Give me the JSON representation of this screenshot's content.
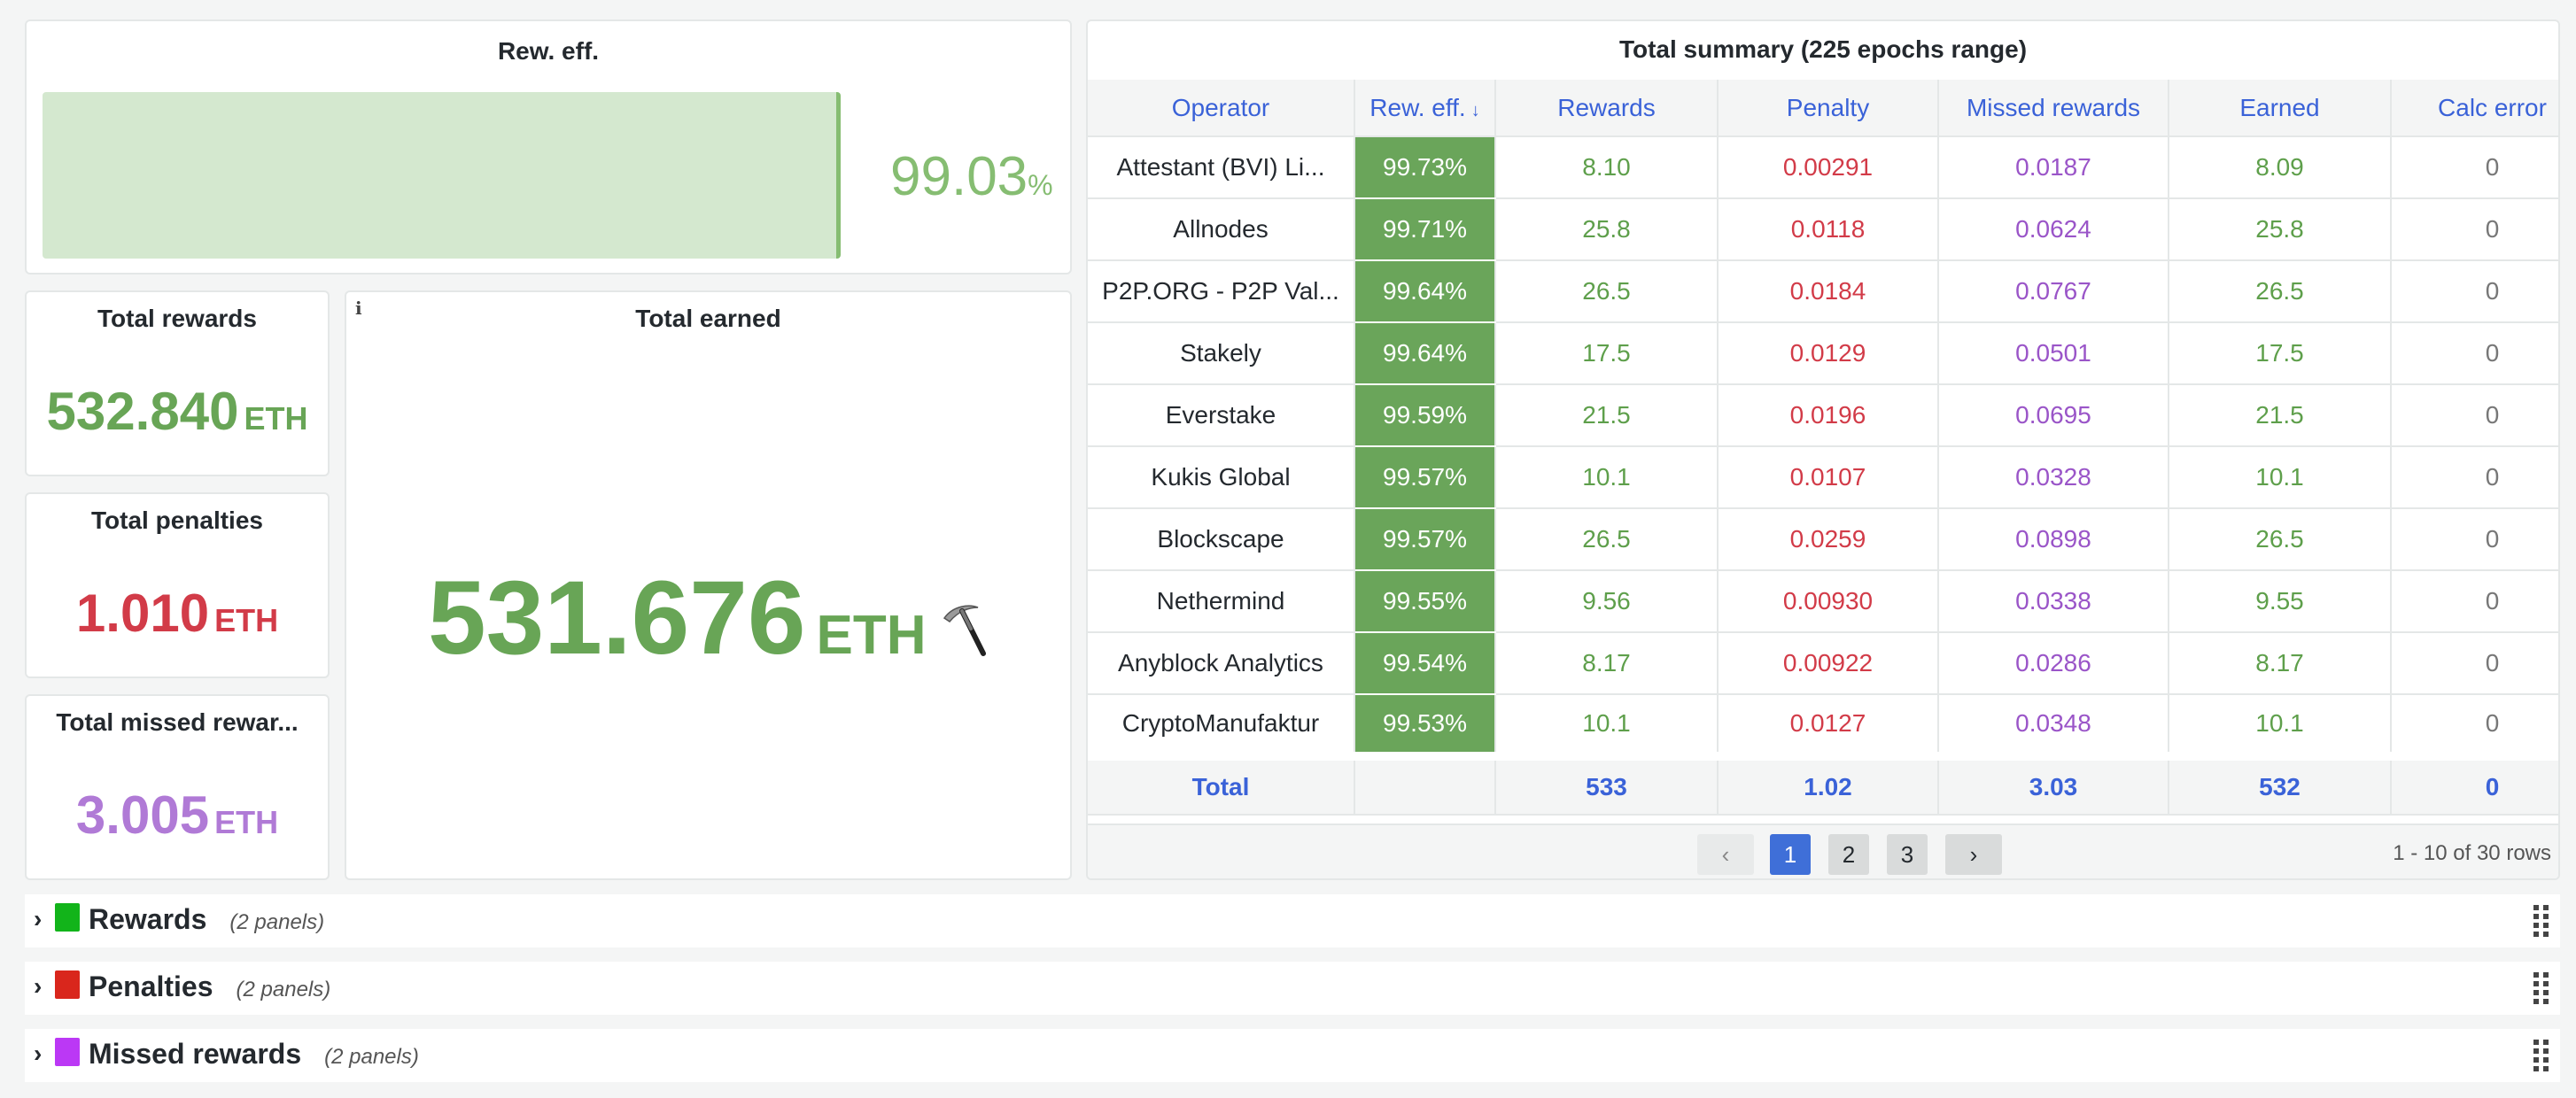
{
  "reward_efficiency": {
    "title": "Rew. eff.",
    "value": "99.03",
    "unit": "%",
    "fraction": 0.9903,
    "color": "#86bd72"
  },
  "stats": {
    "total_rewards": {
      "title": "Total rewards",
      "value": "532.840",
      "unit": "ETH",
      "color": "#68a556"
    },
    "total_penalties": {
      "title": "Total penalties",
      "value": "1.010",
      "unit": "ETH",
      "color": "#d23b48"
    },
    "total_missed": {
      "title": "Total missed rewar...",
      "value": "3.005",
      "unit": "ETH",
      "color": "#b07ad6"
    },
    "total_earned": {
      "title": "Total earned",
      "value": "531.676",
      "unit": "ETH",
      "icon": "pickaxe-icon",
      "info_icon": "i"
    }
  },
  "summary_table": {
    "title": "Total summary (225 epochs range)",
    "columns": [
      "Operator",
      "Rew. eff.",
      "Rewards",
      "Penalty",
      "Missed rewards",
      "Earned",
      "Calc error"
    ],
    "sort_indicator": "↓",
    "rows": [
      [
        "Attestant (BVI) Li...",
        "99.73%",
        "8.10",
        "0.00291",
        "0.0187",
        "8.09",
        "0"
      ],
      [
        "Allnodes",
        "99.71%",
        "25.8",
        "0.0118",
        "0.0624",
        "25.8",
        "0"
      ],
      [
        "P2P.ORG - P2P Val...",
        "99.64%",
        "26.5",
        "0.0184",
        "0.0767",
        "26.5",
        "0"
      ],
      [
        "Stakely",
        "99.64%",
        "17.5",
        "0.0129",
        "0.0501",
        "17.5",
        "0"
      ],
      [
        "Everstake",
        "99.59%",
        "21.5",
        "0.0196",
        "0.0695",
        "21.5",
        "0"
      ],
      [
        "Kukis Global",
        "99.57%",
        "10.1",
        "0.0107",
        "0.0328",
        "10.1",
        "0"
      ],
      [
        "Blockscape",
        "99.57%",
        "26.5",
        "0.0259",
        "0.0898",
        "26.5",
        "0"
      ],
      [
        "Nethermind",
        "99.55%",
        "9.56",
        "0.00930",
        "0.0338",
        "9.55",
        "0"
      ],
      [
        "Anyblock Analytics",
        "99.54%",
        "8.17",
        "0.00922",
        "0.0286",
        "8.17",
        "0"
      ],
      [
        "CryptoManufaktur",
        "99.53%",
        "10.1",
        "0.0127",
        "0.0348",
        "10.1",
        "0"
      ]
    ],
    "total_row": [
      "Total",
      "",
      "533",
      "1.02",
      "3.03",
      "532",
      "0"
    ],
    "pagination": {
      "prev": "‹",
      "pages": [
        "1",
        "2",
        "3"
      ],
      "current": "1",
      "next": "›",
      "info": "1 - 10 of 30 rows"
    }
  },
  "collapsed_rows": [
    {
      "title": "Rewards",
      "count": "(2 panels)",
      "swatch": "#12b41a"
    },
    {
      "title": "Penalties",
      "count": "(2 panels)",
      "swatch": "#d9261c"
    },
    {
      "title": "Missed rewards",
      "count": "(2 panels)",
      "swatch": "#bb38f5"
    }
  ]
}
